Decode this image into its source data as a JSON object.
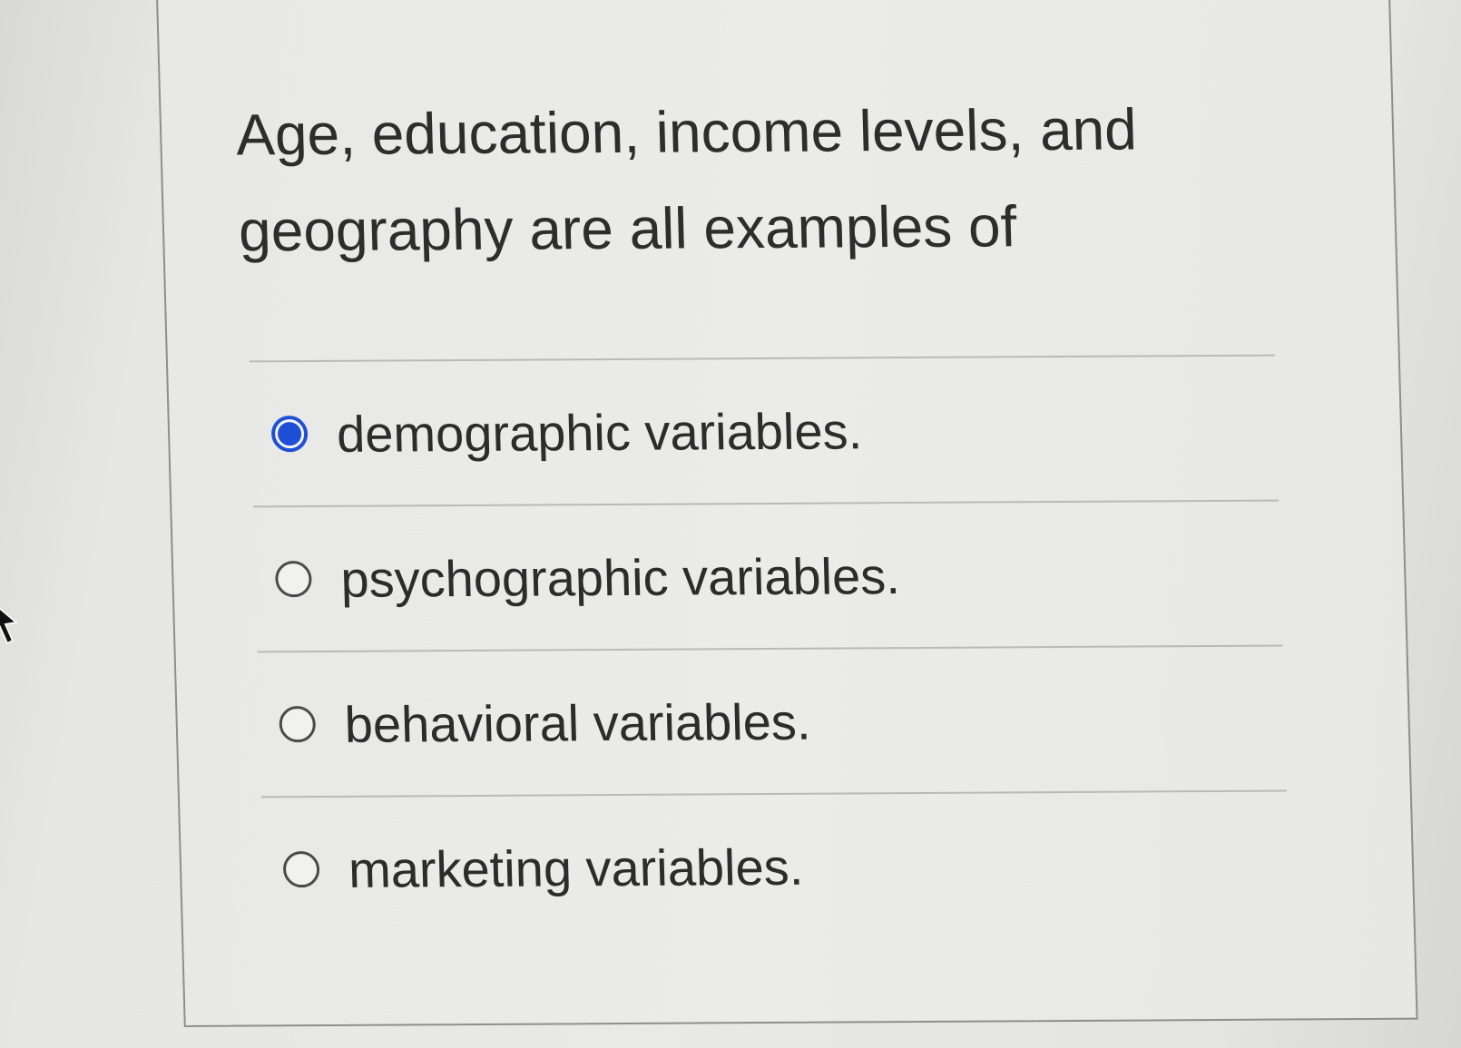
{
  "question": {
    "text": "Age, education, income levels, and geography are all examples of"
  },
  "answers": [
    {
      "label": "demographic variables.",
      "selected": true
    },
    {
      "label": "psychographic variables.",
      "selected": false
    },
    {
      "label": "behavioral variables.",
      "selected": false
    },
    {
      "label": "marketing variables.",
      "selected": false
    }
  ],
  "colors": {
    "accent": "#1f4fd6",
    "text": "#2c2c2c",
    "divider": "#b9b9b6"
  }
}
